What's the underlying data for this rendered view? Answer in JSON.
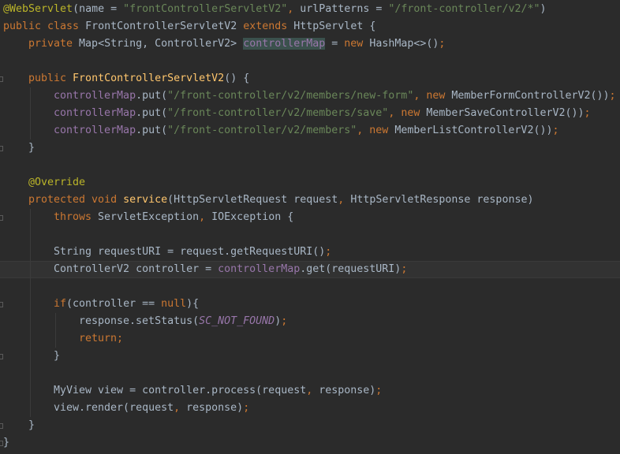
{
  "editor": {
    "theme": {
      "background": "#2b2b2b",
      "current_line": "#323232"
    },
    "lines": [
      {
        "n": 1,
        "indent": 0,
        "tokens": [
          {
            "t": "@WebServlet",
            "c": "ann"
          },
          {
            "t": "(name = ",
            "c": "txt"
          },
          {
            "t": "\"frontControllerServletV2\"",
            "c": "str"
          },
          {
            "t": ", ",
            "c": "pun"
          },
          {
            "t": "urlPatterns = ",
            "c": "txt"
          },
          {
            "t": "\"/front-controller/v2/*\"",
            "c": "str"
          },
          {
            "t": ")",
            "c": "txt"
          }
        ]
      },
      {
        "n": 2,
        "indent": 0,
        "tokens": [
          {
            "t": "public class ",
            "c": "kw"
          },
          {
            "t": "FrontControllerServletV2 ",
            "c": "txt"
          },
          {
            "t": "extends ",
            "c": "kw"
          },
          {
            "t": "HttpServlet {",
            "c": "txt"
          }
        ]
      },
      {
        "n": 3,
        "indent": 1,
        "tokens": [
          {
            "t": "private ",
            "c": "kw"
          },
          {
            "t": "Map<String, ControllerV2> ",
            "c": "txt"
          },
          {
            "t": "controllerMap",
            "c": "fld",
            "hl": true
          },
          {
            "t": " = ",
            "c": "txt"
          },
          {
            "t": "new ",
            "c": "kw"
          },
          {
            "t": "HashMap<>()",
            "c": "txt"
          },
          {
            "t": ";",
            "c": "pun"
          }
        ]
      },
      {
        "n": 4,
        "indent": 0,
        "tokens": []
      },
      {
        "n": 5,
        "indent": 1,
        "fold": true,
        "tokens": [
          {
            "t": "public ",
            "c": "kw"
          },
          {
            "t": "FrontControllerServletV2",
            "c": "fn"
          },
          {
            "t": "() {",
            "c": "txt"
          }
        ]
      },
      {
        "n": 6,
        "indent": 2,
        "tokens": [
          {
            "t": "controllerMap",
            "c": "fld"
          },
          {
            "t": ".put(",
            "c": "txt"
          },
          {
            "t": "\"/front-controller/v2/members/new-form\"",
            "c": "str"
          },
          {
            "t": ", ",
            "c": "pun"
          },
          {
            "t": "new ",
            "c": "kw"
          },
          {
            "t": "MemberFormControllerV2())",
            "c": "txt"
          },
          {
            "t": ";",
            "c": "pun"
          }
        ]
      },
      {
        "n": 7,
        "indent": 2,
        "tokens": [
          {
            "t": "controllerMap",
            "c": "fld"
          },
          {
            "t": ".put(",
            "c": "txt"
          },
          {
            "t": "\"/front-controller/v2/members/save\"",
            "c": "str"
          },
          {
            "t": ", ",
            "c": "pun"
          },
          {
            "t": "new ",
            "c": "kw"
          },
          {
            "t": "MemberSaveControllerV2())",
            "c": "txt"
          },
          {
            "t": ";",
            "c": "pun"
          }
        ]
      },
      {
        "n": 8,
        "indent": 2,
        "tokens": [
          {
            "t": "controllerMap",
            "c": "fld"
          },
          {
            "t": ".put(",
            "c": "txt"
          },
          {
            "t": "\"/front-controller/v2/members\"",
            "c": "str"
          },
          {
            "t": ", ",
            "c": "pun"
          },
          {
            "t": "new ",
            "c": "kw"
          },
          {
            "t": "MemberListControllerV2())",
            "c": "txt"
          },
          {
            "t": ";",
            "c": "pun"
          }
        ]
      },
      {
        "n": 9,
        "indent": 1,
        "fold": true,
        "tokens": [
          {
            "t": "}",
            "c": "txt"
          }
        ]
      },
      {
        "n": 10,
        "indent": 0,
        "tokens": []
      },
      {
        "n": 11,
        "indent": 1,
        "tokens": [
          {
            "t": "@Override",
            "c": "ann"
          }
        ]
      },
      {
        "n": 12,
        "indent": 1,
        "tokens": [
          {
            "t": "protected void ",
            "c": "kw"
          },
          {
            "t": "service",
            "c": "fn"
          },
          {
            "t": "(HttpServletRequest request",
            "c": "txt"
          },
          {
            "t": ", ",
            "c": "pun"
          },
          {
            "t": "HttpServletResponse response)",
            "c": "txt"
          }
        ]
      },
      {
        "n": 13,
        "indent": 2,
        "fold": true,
        "tokens": [
          {
            "t": "throws ",
            "c": "kw"
          },
          {
            "t": "ServletException",
            "c": "txt"
          },
          {
            "t": ", ",
            "c": "pun"
          },
          {
            "t": "IOException {",
            "c": "txt"
          }
        ]
      },
      {
        "n": 14,
        "indent": 0,
        "tokens": []
      },
      {
        "n": 15,
        "indent": 2,
        "tokens": [
          {
            "t": "String requestURI = request.getRequestURI()",
            "c": "txt"
          },
          {
            "t": ";",
            "c": "pun"
          }
        ]
      },
      {
        "n": 16,
        "indent": 2,
        "current": true,
        "tokens": [
          {
            "t": "ControllerV2 controller = ",
            "c": "txt"
          },
          {
            "t": "controllerMap",
            "c": "fld"
          },
          {
            "t": ".get(requestURI)",
            "c": "txt"
          },
          {
            "t": ";",
            "c": "pun"
          }
        ]
      },
      {
        "n": 17,
        "indent": 0,
        "tokens": []
      },
      {
        "n": 18,
        "indent": 2,
        "fold": true,
        "tokens": [
          {
            "t": "if",
            "c": "kw"
          },
          {
            "t": "(controller == ",
            "c": "txt"
          },
          {
            "t": "null",
            "c": "kw"
          },
          {
            "t": "){",
            "c": "txt"
          }
        ]
      },
      {
        "n": 19,
        "indent": 3,
        "tokens": [
          {
            "t": "response.setStatus(",
            "c": "txt"
          },
          {
            "t": "SC_NOT_FOUND",
            "c": "const"
          },
          {
            "t": ")",
            "c": "txt"
          },
          {
            "t": ";",
            "c": "pun"
          }
        ]
      },
      {
        "n": 20,
        "indent": 3,
        "tokens": [
          {
            "t": "return;",
            "c": "kw"
          }
        ]
      },
      {
        "n": 21,
        "indent": 2,
        "fold": true,
        "tokens": [
          {
            "t": "}",
            "c": "txt"
          }
        ]
      },
      {
        "n": 22,
        "indent": 0,
        "tokens": []
      },
      {
        "n": 23,
        "indent": 2,
        "tokens": [
          {
            "t": "MyView view = controller.process(request",
            "c": "txt"
          },
          {
            "t": ", ",
            "c": "pun"
          },
          {
            "t": "response)",
            "c": "txt"
          },
          {
            "t": ";",
            "c": "pun"
          }
        ]
      },
      {
        "n": 24,
        "indent": 2,
        "tokens": [
          {
            "t": "view.render(request",
            "c": "txt"
          },
          {
            "t": ", ",
            "c": "pun"
          },
          {
            "t": "response)",
            "c": "txt"
          },
          {
            "t": ";",
            "c": "pun"
          }
        ]
      },
      {
        "n": 25,
        "indent": 1,
        "fold": true,
        "tokens": [
          {
            "t": "}",
            "c": "txt"
          }
        ]
      },
      {
        "n": 26,
        "indent": 0,
        "fold": true,
        "tokens": [
          {
            "t": "}",
            "c": "txt"
          }
        ]
      }
    ]
  }
}
